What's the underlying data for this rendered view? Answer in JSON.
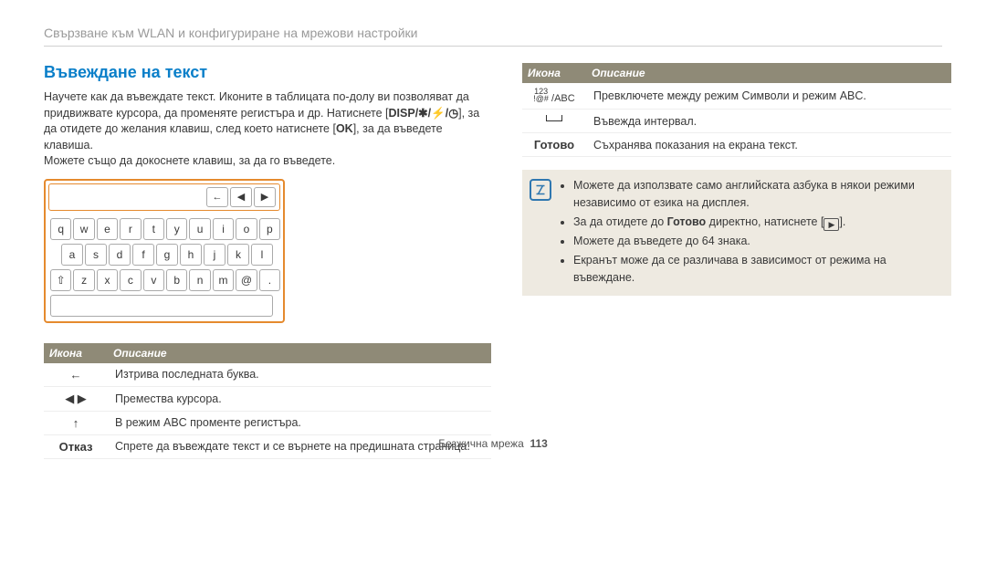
{
  "breadcrumb": "Свързване към WLAN и конфигуриране на мрежови настройки",
  "section_title": "Въвеждане на текст",
  "intro": {
    "l1": "Научете как да въвеждате текст. Иконите в таблицата по-долу ви позволяват да",
    "l2a": "придвижвате курсора, да променяте регистъра и др. Натиснете [",
    "l2b_disp": "DISP",
    "l2c": "], за",
    "l3a": "да отидете до желания клавиш, след което натиснете [",
    "l3b_ok": "OK",
    "l3c": "], за да въведете клавиша.",
    "l4": "Можете също да докоснете клавиш, за да го въведете."
  },
  "keyboard": {
    "row1": [
      "q",
      "w",
      "e",
      "r",
      "t",
      "y",
      "u",
      "i",
      "o",
      "p"
    ],
    "row2": [
      "a",
      "s",
      "d",
      "f",
      "g",
      "h",
      "j",
      "k",
      "l"
    ],
    "row3": [
      "⇧",
      "z",
      "x",
      "c",
      "v",
      "b",
      "n",
      "m",
      "@",
      "."
    ]
  },
  "left_table": {
    "header": {
      "icon": "Икона",
      "desc": "Описание"
    },
    "rows": [
      {
        "icon": "←",
        "desc": "Изтрива последната буква."
      },
      {
        "icon": "◀ ▶",
        "desc": "Премества курсора."
      },
      {
        "icon": "↑",
        "desc": "В режим ABC променте регистъра."
      }
    ],
    "row_cancel": {
      "label": "Отказ",
      "desc": "Спрете да въвеждате текст и се върнете на предишната страница."
    }
  },
  "right_table": {
    "header": {
      "icon": "Икона",
      "desc": "Описание"
    },
    "rows": [
      {
        "icon_html": "symabc",
        "desc": "Превключете между режим Символи и режим ABC."
      },
      {
        "icon_html": "space",
        "desc": "Въвежда интервал."
      }
    ],
    "row_done": {
      "label": "Готово",
      "desc": "Съхранява показания на екрана текст."
    }
  },
  "symabc": {
    "top": "123\n!@#",
    "slash": " /",
    "abc": "ABC"
  },
  "note": [
    "Можете да използвате само английската азбука в някои режими независимо от езика на дисплея.",
    "За да отидете до Готово директно, натиснете [▶].",
    "Можете да въведете до 64 знака.",
    "Екранът може да се различава в зависимост от режима на въвеждане."
  ],
  "note_bold": "Готово",
  "footer": {
    "section": "Безжична мрежа",
    "page": "113"
  }
}
